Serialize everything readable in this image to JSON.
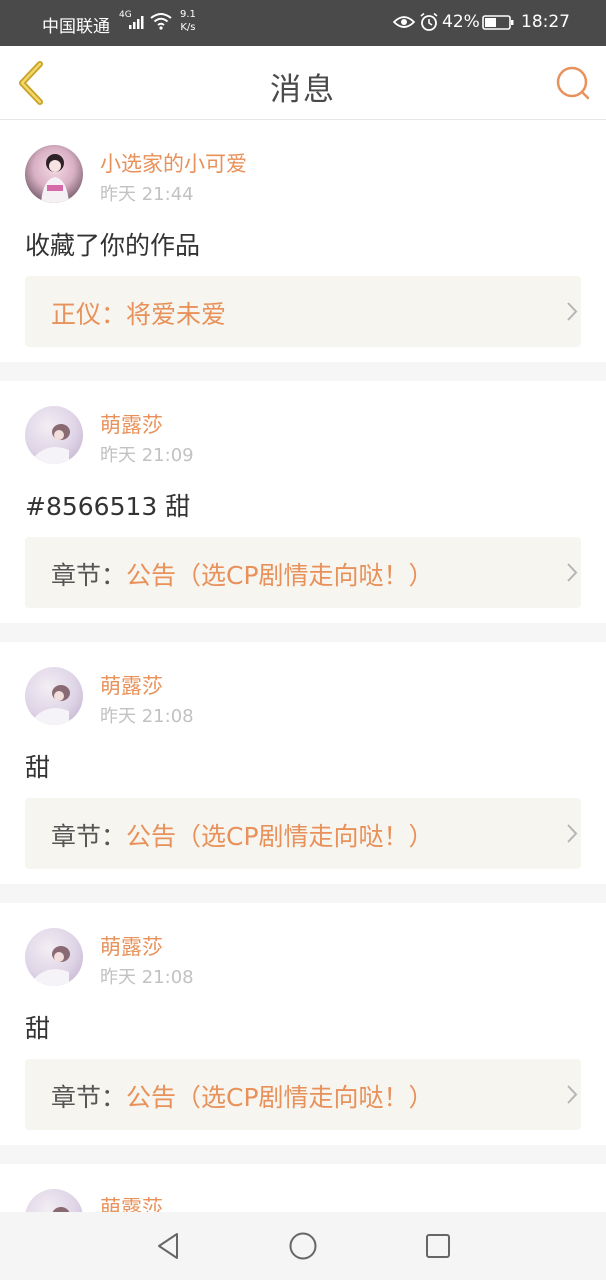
{
  "status_bar": {
    "carrier": "中国联通",
    "network_badge": "4G",
    "net_speed_value": "9.1",
    "net_speed_unit": "K/s",
    "battery_percent": "42%",
    "time": "18:27",
    "icons": [
      "signal-icon",
      "wifi-icon",
      "eye-icon",
      "alarm-icon",
      "battery-icon"
    ]
  },
  "header": {
    "title": "消息",
    "back_icon": "chevron-left-icon",
    "search_icon": "search-icon",
    "accent_color": "#e8915a"
  },
  "messages": [
    {
      "user": "小选家的小可爱",
      "time": "昨天 21:44",
      "text": "收藏了你的作品",
      "ref_prefix": "正仪：",
      "ref_title": "将爱未爱"
    },
    {
      "user": "萌露莎",
      "time": "昨天 21:09",
      "text": "#8566513 甜",
      "ref_prefix": "章节：",
      "ref_title": "公告（选CP剧情走向哒！）"
    },
    {
      "user": "萌露莎",
      "time": "昨天 21:08",
      "text": "甜",
      "ref_prefix": "章节：",
      "ref_title": "公告（选CP剧情走向哒！）"
    },
    {
      "user": "萌露莎",
      "time": "昨天 21:08",
      "text": "甜",
      "ref_prefix": "章节：",
      "ref_title": "公告（选CP剧情走向哒！）"
    },
    {
      "user": "萌露莎"
    }
  ],
  "nav_bar": {
    "icons": [
      "nav-back-icon",
      "nav-home-icon",
      "nav-recents-icon"
    ]
  }
}
